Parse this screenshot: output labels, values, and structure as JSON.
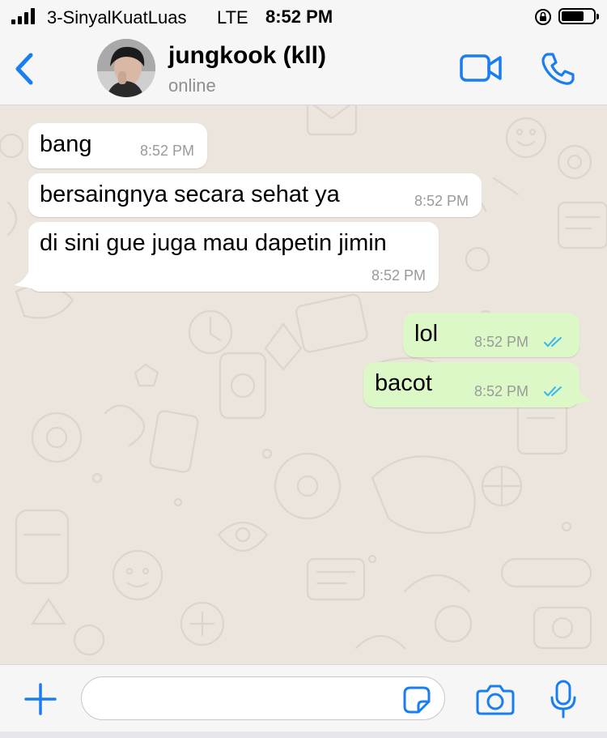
{
  "status_bar": {
    "carrier": "3-SinyalKuatLuas",
    "network": "LTE",
    "time": "8:52 PM"
  },
  "header": {
    "contact_name": "jungkook (kll)",
    "status": "online",
    "icons": [
      "back-chevron-icon",
      "video-call-icon",
      "phone-call-icon"
    ]
  },
  "messages": [
    {
      "direction": "incoming",
      "text": "bang",
      "time": "8:52 PM"
    },
    {
      "direction": "incoming",
      "text": "bersaingnya secara sehat ya",
      "time": "8:52 PM"
    },
    {
      "direction": "incoming",
      "text": "di sini gue juga mau dapetin jimin",
      "time": "8:52 PM"
    },
    {
      "direction": "outgoing",
      "text": "lol",
      "time": "8:52 PM",
      "read": true
    },
    {
      "direction": "outgoing",
      "text": "bacot",
      "time": "8:52 PM",
      "read": true
    }
  ],
  "input_bar": {
    "message_value": "",
    "icons": [
      "plus-icon",
      "sticker-icon",
      "camera-icon",
      "microphone-icon"
    ]
  },
  "colors": {
    "accent": "#1A7DF0",
    "chat_background": "#ECE5DD",
    "incoming_bubble": "#FFFFFF",
    "outgoing_bubble": "#DCF8C6",
    "read_ticks": "#34B7F1"
  }
}
